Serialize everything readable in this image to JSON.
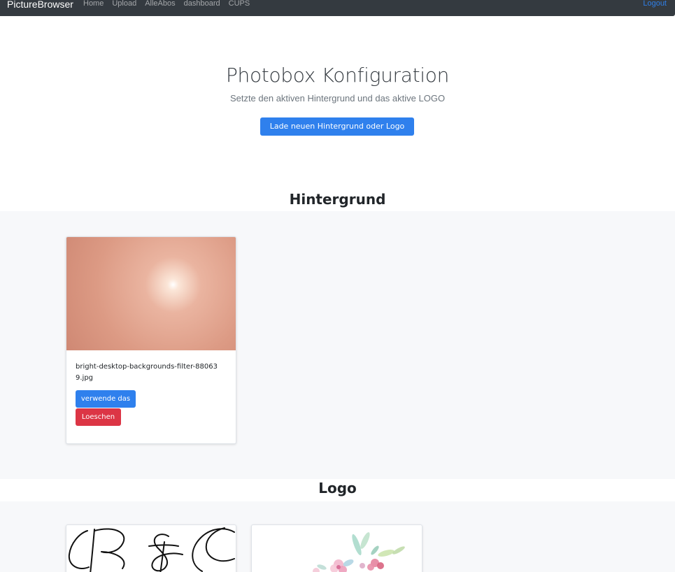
{
  "navbar": {
    "brand": "PictureBrowser",
    "links": [
      "Home",
      "Upload",
      "AlleAbos",
      "dashboard",
      "CUPS"
    ],
    "logout": "Logout"
  },
  "hero": {
    "title": "Photobox Konfiguration",
    "subtitle": "Setzte den aktiven Hintergrund und das aktive LOGO",
    "upload_button": "Lade neuen Hintergrund oder Logo hoch"
  },
  "background_section": {
    "title": "Hintergrund",
    "cards": [
      {
        "filename": "bright-desktop-backgrounds-filter-880639.jpg",
        "use_button": "verwende das",
        "delete_button": "Loeschen"
      }
    ]
  },
  "logo_section": {
    "title": "Logo"
  }
}
